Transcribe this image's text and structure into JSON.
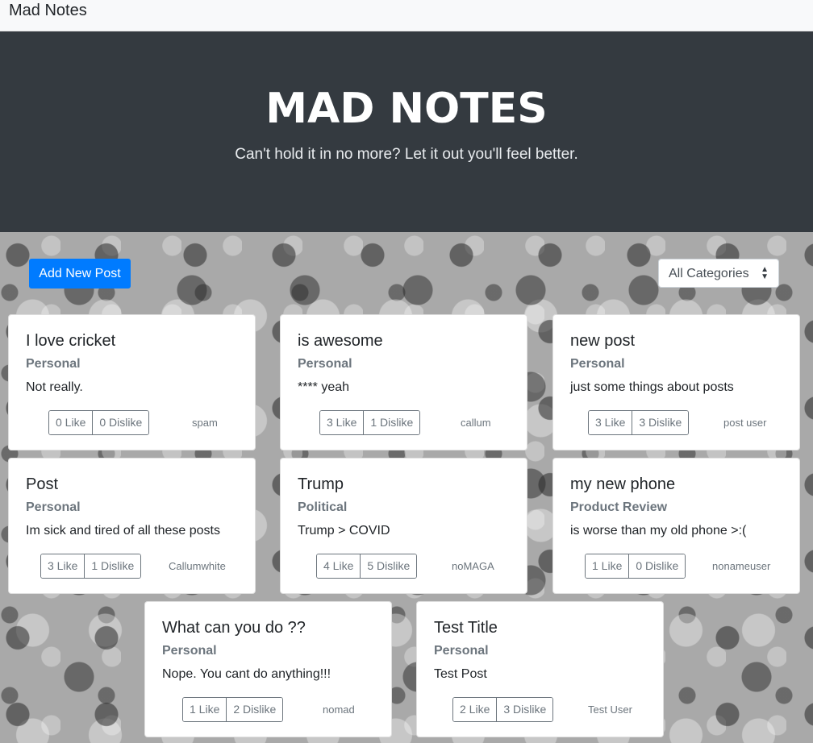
{
  "navbar": {
    "brand": "Mad Notes"
  },
  "hero": {
    "title": "MAD NOTES",
    "subtitle": "Can't hold it in no more? Let it out you'll feel better."
  },
  "toolbar": {
    "add_label": "Add New Post",
    "category_select": "All Categories"
  },
  "posts": [
    {
      "title": "I love cricket",
      "category": "Personal",
      "body": "Not really.",
      "like": "0 Like",
      "dislike": "0 Dislike",
      "author": "spam"
    },
    {
      "title": "is awesome",
      "category": "Personal",
      "body": "**** yeah",
      "like": "3 Like",
      "dislike": "1 Dislike",
      "author": "callum"
    },
    {
      "title": "new post",
      "category": "Personal",
      "body": "just some things about posts",
      "like": "3 Like",
      "dislike": "3 Dislike",
      "author": "post user"
    },
    {
      "title": "Post",
      "category": "Personal",
      "body": "Im sick and tired of all these posts",
      "like": "3 Like",
      "dislike": "1 Dislike",
      "author": "Callumwhite"
    },
    {
      "title": "Trump",
      "category": "Political",
      "body": "Trump > COVID",
      "like": "4 Like",
      "dislike": "5 Dislike",
      "author": "noMAGA"
    },
    {
      "title": "my new phone",
      "category": "Product Review",
      "body": "is worse than my old phone >:(",
      "like": "1 Like",
      "dislike": "0 Dislike",
      "author": "nonameuser"
    },
    {
      "title": "What can you do ??",
      "category": "Personal",
      "body": "Nope. You cant do anything!!!",
      "like": "1 Like",
      "dislike": "2 Dislike",
      "author": "nomad"
    },
    {
      "title": "Test Title",
      "category": "Personal",
      "body": "Test Post",
      "like": "2 Like",
      "dislike": "3 Dislike",
      "author": "Test User"
    }
  ]
}
